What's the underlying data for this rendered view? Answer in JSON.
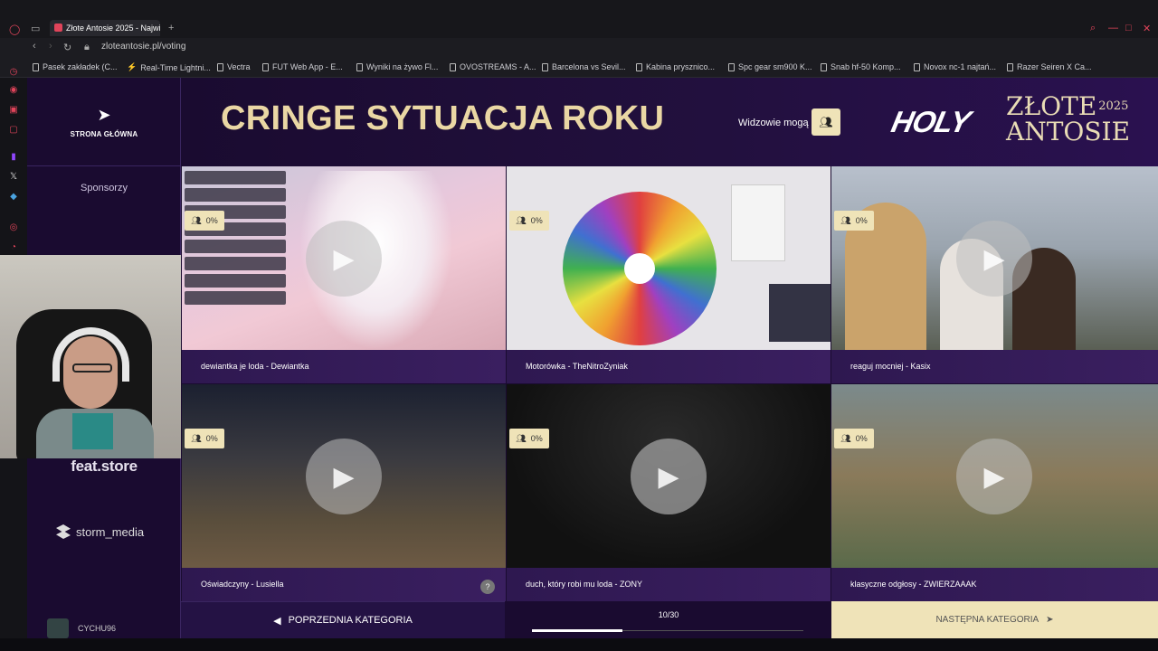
{
  "browser": {
    "tab_title": "Złote Antosie 2025 - Najwi",
    "url": "zloteantosie.pl/voting",
    "bookmarks": [
      "Pasek zakładek (C...",
      "Real-Time Lightni...",
      "Vectra",
      "FUT Web App - E...",
      "Wyniki na żywo Fl...",
      "OVOSTREAMS - A...",
      "Barcelona vs Sevil...",
      "Kabina prysznico...",
      "Spc gear sm900 K...",
      "Snab hf-50 Komp...",
      "Novox nc-1 najtań...",
      "Razer Seiren X Ca..."
    ]
  },
  "nav": {
    "home_label": "STRONA GŁÓWNA",
    "sponsors_label": "Sponsorzy",
    "sponsor1": "feat.store",
    "sponsor2": "storm_media",
    "user": "CYCHU96"
  },
  "header": {
    "title": "CRINGE SYTUACJA ROKU",
    "viewers_label": "Widzowie mogą",
    "brand_holy": "HOLY",
    "brand_line1": "ZŁOTE",
    "brand_year": "2025",
    "brand_line2": "ANTOSIE"
  },
  "cards": [
    {
      "caption": "dewiantka je loda - Dewiantka",
      "percent": "0%"
    },
    {
      "caption": "Motorówka - TheNitroZyniak",
      "percent": "0%"
    },
    {
      "caption": "reaguj mocniej - Kasix",
      "percent": "0%"
    },
    {
      "caption": "Oświadczyny - Lusiella",
      "percent": "0%"
    },
    {
      "caption": "duch, który robi mu loda - ZONY",
      "percent": "0%"
    },
    {
      "caption": "klasyczne odgłosy - ZWIERZAAAK",
      "percent": "0%"
    }
  ],
  "footer": {
    "prev_label": "POPRZEDNIA KATEGORIA",
    "progress_label": "10/30",
    "progress_fraction": 0.3333,
    "next_label": "NASTĘPNA KATEGORIA"
  },
  "colors": {
    "background": "#1a0b30",
    "accent_gold": "#efe3b8",
    "title_gold": "#ead7a4"
  }
}
